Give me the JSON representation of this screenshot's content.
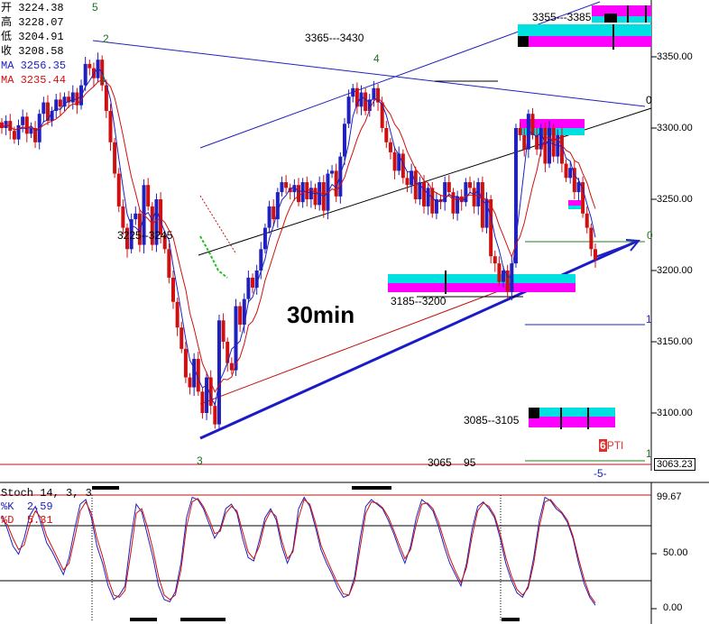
{
  "window": {
    "timeframe_label": "30min"
  },
  "legend": {
    "open": {
      "label": "开",
      "value": "3224.38"
    },
    "high": {
      "label": "高",
      "value": "3228.07"
    },
    "low": {
      "label": "低",
      "value": "3204.91"
    },
    "close": {
      "label": "收",
      "value": "3208.58"
    },
    "ma1": {
      "label": "MA",
      "value": "3256.35",
      "color": "#2020c0"
    },
    "ma2": {
      "label": "MA",
      "value": "3235.44",
      "color": "#d01010"
    }
  },
  "stoch_legend": {
    "title": "Stoch 14, 3, 3",
    "k": {
      "label": "%K",
      "value": "2.59",
      "color": "#2020c0"
    },
    "d": {
      "label": "%D",
      "value": "5.31",
      "color": "#d01010"
    }
  },
  "colors": {
    "bull": "#2020c0",
    "bear": "#d01010",
    "cyan": "#00e0e0",
    "magenta": "#ff00ff",
    "wave_label": "#207020"
  },
  "annotations": {
    "range_top": "3365---3430",
    "range_right_top": "3355---3385",
    "range_left": "3225--3245",
    "range_mid": "3185--3200",
    "range_low": "3085--3105",
    "range_bottom": "3065    95",
    "wave_5": "5",
    "wave_2": "2",
    "wave_1": "1",
    "wave_4": "4",
    "wave_3": "3",
    "right_0a": "0",
    "right_0b": "0",
    "right_1a": "1",
    "right_1b": "1",
    "minus5": "-5-",
    "pti_num": "6",
    "pti_txt": "PTI"
  },
  "price_axis": {
    "cursor_value": "3063.23",
    "stoch_max": "99.67"
  },
  "chart_data": [
    {
      "type": "candlestick",
      "timeframe": "30min",
      "y_axis": {
        "ticks": [
          3100,
          3150,
          3200,
          3250,
          3300,
          3350
        ],
        "tick_labels": [
          "3100.00",
          "3150.00",
          "3200.00",
          "3250.00",
          "3300.00",
          "3350.00"
        ],
        "range": [
          3063,
          3395
        ],
        "position": "right"
      },
      "close_path": [
        3300,
        3305,
        3298,
        3292,
        3302,
        3308,
        3296,
        3300,
        3290,
        3310,
        3318,
        3305,
        3312,
        3320,
        3315,
        3322,
        3318,
        3325,
        3316,
        3330,
        3345,
        3342,
        3335,
        3348,
        3330,
        3312,
        3290,
        3268,
        3245,
        3230,
        3215,
        3236,
        3240,
        3218,
        3260,
        3245,
        3218,
        3250,
        3225,
        3215,
        3195,
        3178,
        3160,
        3145,
        3125,
        3118,
        3138,
        3115,
        3100,
        3125,
        3105,
        3092,
        3165,
        3150,
        3135,
        3130,
        3175,
        3162,
        3180,
        3195,
        3188,
        3200,
        3215,
        3230,
        3245,
        3236,
        3255,
        3262,
        3258,
        3255,
        3260,
        3248,
        3262,
        3250,
        3258,
        3246,
        3262,
        3242,
        3268,
        3270,
        3252,
        3280,
        3303,
        3322,
        3328,
        3315,
        3325,
        3312,
        3320,
        3328,
        3318,
        3300,
        3290,
        3283,
        3270,
        3282,
        3265,
        3260,
        3270,
        3250,
        3262,
        3245,
        3258,
        3240,
        3250,
        3248,
        3262,
        3255,
        3240,
        3252,
        3248,
        3262,
        3258,
        3245,
        3262,
        3230,
        3250,
        3210,
        3205,
        3192,
        3200,
        3185,
        3205,
        3300,
        3295,
        3285,
        3310,
        3295,
        3285,
        3300,
        3275,
        3300,
        3280,
        3295,
        3275,
        3265,
        3272,
        3255,
        3262,
        3240,
        3230,
        3215,
        3208
      ]
    },
    {
      "type": "line",
      "title": "Stoch 14, 3, 3",
      "y_ticks": [
        "0.00",
        "50.00"
      ],
      "y_range": [
        0,
        100
      ],
      "series": [
        {
          "name": "%K",
          "color": "#2020c0",
          "values": [
            82,
            70,
            55,
            48,
            62,
            82,
            90,
            75,
            58,
            50,
            40,
            30,
            45,
            70,
            92,
            96,
            80,
            55,
            40,
            20,
            8,
            12,
            20,
            60,
            92,
            85,
            65,
            45,
            20,
            8,
            6,
            15,
            40,
            80,
            98,
            96,
            88,
            75,
            62,
            70,
            88,
            92,
            84,
            62,
            45,
            42,
            60,
            80,
            88,
            78,
            55,
            40,
            52,
            88,
            98,
            90,
            72,
            52,
            40,
            30,
            18,
            10,
            12,
            28,
            62,
            90,
            96,
            92,
            88,
            78,
            66,
            52,
            40,
            55,
            80,
            96,
            92,
            86,
            72,
            55,
            40,
            30,
            20,
            40,
            70,
            90,
            94,
            88,
            80,
            62,
            40,
            25,
            14,
            10,
            20,
            45,
            78,
            98,
            95,
            88,
            84,
            76,
            62,
            40,
            22,
            10,
            3
          ]
        },
        {
          "name": "%D",
          "color": "#d01010",
          "values": [
            78,
            74,
            62,
            52,
            56,
            74,
            86,
            80,
            64,
            54,
            44,
            34,
            40,
            62,
            86,
            94,
            84,
            62,
            46,
            26,
            12,
            10,
            16,
            48,
            84,
            88,
            72,
            52,
            28,
            12,
            8,
            12,
            34,
            72,
            94,
            97,
            90,
            79,
            66,
            68,
            84,
            90,
            86,
            68,
            50,
            44,
            55,
            76,
            86,
            81,
            60,
            44,
            50,
            80,
            96,
            92,
            76,
            56,
            44,
            33,
            22,
            13,
            12,
            24,
            54,
            84,
            94,
            93,
            89,
            81,
            69,
            56,
            44,
            52,
            74,
            92,
            93,
            88,
            76,
            60,
            45,
            33,
            23,
            36,
            64,
            86,
            93,
            90,
            82,
            66,
            45,
            29,
            17,
            12,
            18,
            40,
            72,
            94,
            96,
            90,
            85,
            78,
            64,
            44,
            26,
            12,
            5
          ]
        }
      ]
    }
  ]
}
